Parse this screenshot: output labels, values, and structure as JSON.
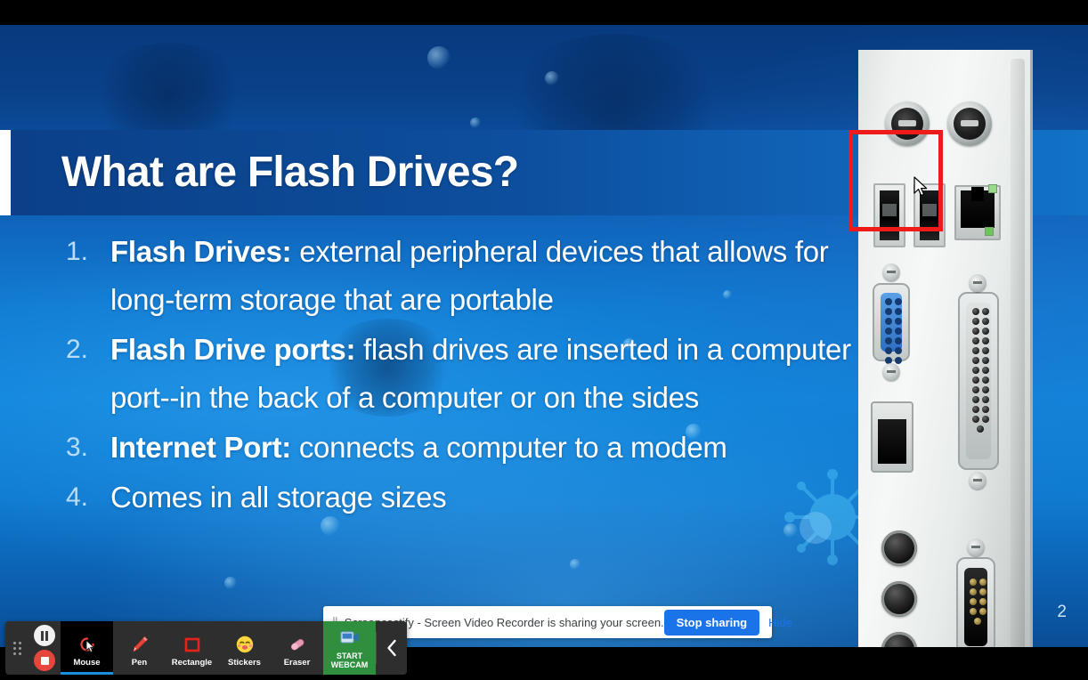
{
  "slide": {
    "title": "What are Flash Drives?",
    "number": "2",
    "bullets": [
      {
        "num": "1.",
        "bold": "Flash Drives:",
        "rest": " external peripheral devices that allows for long-term storage that are portable"
      },
      {
        "num": "2.",
        "bold": "Flash Drive ports:",
        "rest": " flash drives are inserted in a computer port--in the back of a computer or on the sides"
      },
      {
        "num": "3.",
        "bold": "Internet Port:",
        "rest": " connects a computer to a modem"
      },
      {
        "num": "4.",
        "bold": "",
        "rest": "Comes in all storage sizes"
      }
    ],
    "image_alt": "computer-rear-io-panel-photo"
  },
  "annotation": {
    "shape": "rectangle",
    "color": "#ef1b1b"
  },
  "sharing_bar": {
    "pause_glyph": "||",
    "message": "Screencastify - Screen Video Recorder is sharing your screen.",
    "stop_label": "Stop sharing",
    "hide_label": "Hide"
  },
  "toolbar": {
    "tools": [
      {
        "name": "mouse",
        "label": "Mouse",
        "active": true
      },
      {
        "name": "pen",
        "label": "Pen",
        "active": false
      },
      {
        "name": "rectangle",
        "label": "Rectangle",
        "active": false
      },
      {
        "name": "stickers",
        "label": "Stickers",
        "active": false
      },
      {
        "name": "eraser",
        "label": "Eraser",
        "active": false
      }
    ],
    "webcam_label_line1": "START",
    "webcam_label_line2": "WEBCAM",
    "pause_icon": "pause-icon",
    "stop_icon": "stop-icon",
    "drag_icon": "drag-handle-icon",
    "collapse_icon": "chevron-left-icon"
  },
  "colors": {
    "accent_blue": "#1a73e8",
    "annotation_red": "#ef1b1b",
    "webcam_green": "#2f8f3f",
    "active_underline": "#1a8fe0",
    "slide_blue": "#117cd2",
    "title_band": "#0c4691"
  }
}
